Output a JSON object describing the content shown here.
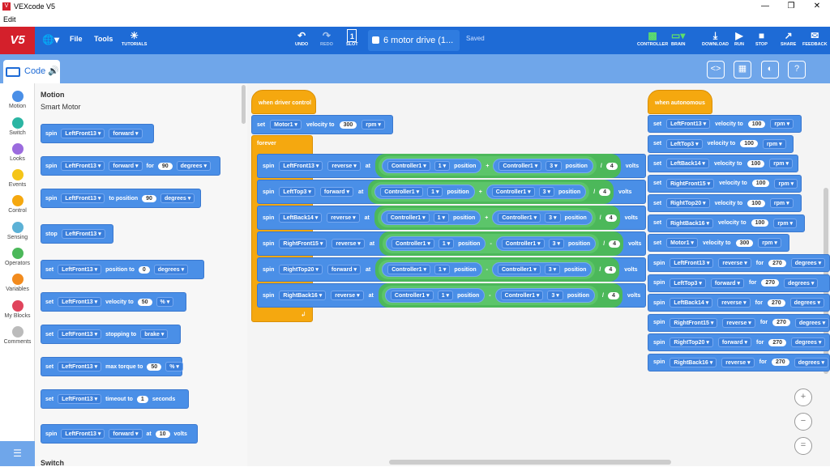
{
  "app": {
    "title": "VEXcode V5",
    "menu_edit": "Edit",
    "logo": "V5"
  },
  "toolbar": {
    "file": "File",
    "tools": "Tools",
    "tutorials": "TUTORIALS",
    "undo": "UNDO",
    "redo": "REDO",
    "slot": "SLOT",
    "slot_num": "1",
    "project_name": "6 motor drive (1...",
    "saved": "Saved",
    "controller": "CONTROLLER",
    "brain": "BRAIN",
    "download": "DOWNLOAD",
    "run": "RUN",
    "stop": "STOP",
    "share": "SHARE",
    "feedback": "FEEDBACK"
  },
  "code_tab": "Code",
  "categories": [
    "Motion",
    "Switch",
    "Looks",
    "Events",
    "Control",
    "Sensing",
    "Operators",
    "Variables",
    "My Blocks",
    "Comments"
  ],
  "category_colors": [
    "#4a8fe7",
    "#2bb5a3",
    "#9b6bde",
    "#f5c518",
    "#f5a80f",
    "#5cb1d6",
    "#4cb85a",
    "#f28b1e",
    "#e0445c",
    "#bbbbbb"
  ],
  "palette": {
    "heading": "Motion",
    "subheading": "Smart Motor",
    "footer": "Switch",
    "blocks": [
      {
        "words": [
          "spin"
        ],
        "motor": "LeftFront13",
        "dir": "forward"
      },
      {
        "words": [
          "spin"
        ],
        "motor": "LeftFront13",
        "dir": "forward",
        "for_word": "for",
        "num": "90",
        "unit": "degrees"
      },
      {
        "words": [
          "spin"
        ],
        "motor": "LeftFront13",
        "to": "to position",
        "num": "90",
        "unit": "degrees"
      },
      {
        "words": [
          "stop"
        ],
        "motor": "LeftFront13"
      },
      {
        "words": [
          "set"
        ],
        "motor": "LeftFront13",
        "label": "position to",
        "num": "0",
        "unit": "degrees"
      },
      {
        "words": [
          "set"
        ],
        "motor": "LeftFront13",
        "label": "velocity to",
        "num": "50",
        "unit": "%"
      },
      {
        "words": [
          "set"
        ],
        "motor": "LeftFront13",
        "label": "stopping to",
        "unit": "brake"
      },
      {
        "words": [
          "set"
        ],
        "motor": "LeftFront13",
        "label": "max torque to",
        "num": "50",
        "unit": "%"
      },
      {
        "words": [
          "set"
        ],
        "motor": "LeftFront13",
        "label": "timeout to",
        "num": "1",
        "unit": "seconds"
      },
      {
        "words": [
          "spin"
        ],
        "motor": "LeftFront13",
        "dir": "forward",
        "at": "at",
        "num": "10",
        "unit": "volts"
      }
    ]
  },
  "driver": {
    "hat": "when driver control",
    "set_word": "set",
    "motor": "Motor1",
    "vel_label": "velocity to",
    "vel": "300",
    "vel_unit": "rpm",
    "forever": "forever",
    "spin_rows": [
      {
        "motor": "LeftFront13",
        "dir": "reverse",
        "op": "+"
      },
      {
        "motor": "LeftTop3",
        "dir": "forward",
        "op": "+"
      },
      {
        "motor": "LeftBack14",
        "dir": "reverse",
        "op": "+"
      },
      {
        "motor": "RightFront15",
        "dir": "reverse",
        "op": "-"
      },
      {
        "motor": "RightTop20",
        "dir": "forward",
        "op": "-"
      },
      {
        "motor": "RightBack16",
        "dir": "reverse",
        "op": "-"
      }
    ],
    "spin": "spin",
    "at": "at",
    "controller": "Controller1",
    "axis_a": "1",
    "axis_b": "3",
    "position": "position",
    "div": "/",
    "divisor": "4",
    "volts": "volts"
  },
  "auton": {
    "hat": "when autonomous",
    "sets": [
      {
        "motor": "LeftFront13",
        "vel": "100"
      },
      {
        "motor": "LeftTop3",
        "vel": "100"
      },
      {
        "motor": "LeftBack14",
        "vel": "100"
      },
      {
        "motor": "RightFront15",
        "vel": "100"
      },
      {
        "motor": "RightTop20",
        "vel": "100"
      },
      {
        "motor": "RightBack16",
        "vel": "100"
      },
      {
        "motor": "Motor1",
        "vel": "300"
      }
    ],
    "spins": [
      {
        "motor": "LeftFront13",
        "dir": "reverse",
        "num": "270"
      },
      {
        "motor": "LeftTop3",
        "dir": "forward",
        "num": "270"
      },
      {
        "motor": "LeftBack14",
        "dir": "reverse",
        "num": "270"
      },
      {
        "motor": "RightFront15",
        "dir": "reverse",
        "num": "270"
      },
      {
        "motor": "RightTop20",
        "dir": "forward",
        "num": "270"
      },
      {
        "motor": "RightBack16",
        "dir": "reverse",
        "num": "270"
      }
    ],
    "set_word": "set",
    "vel_label": "velocity to",
    "rpm": "rpm",
    "spin": "spin",
    "for": "for",
    "degrees": "degrees"
  }
}
